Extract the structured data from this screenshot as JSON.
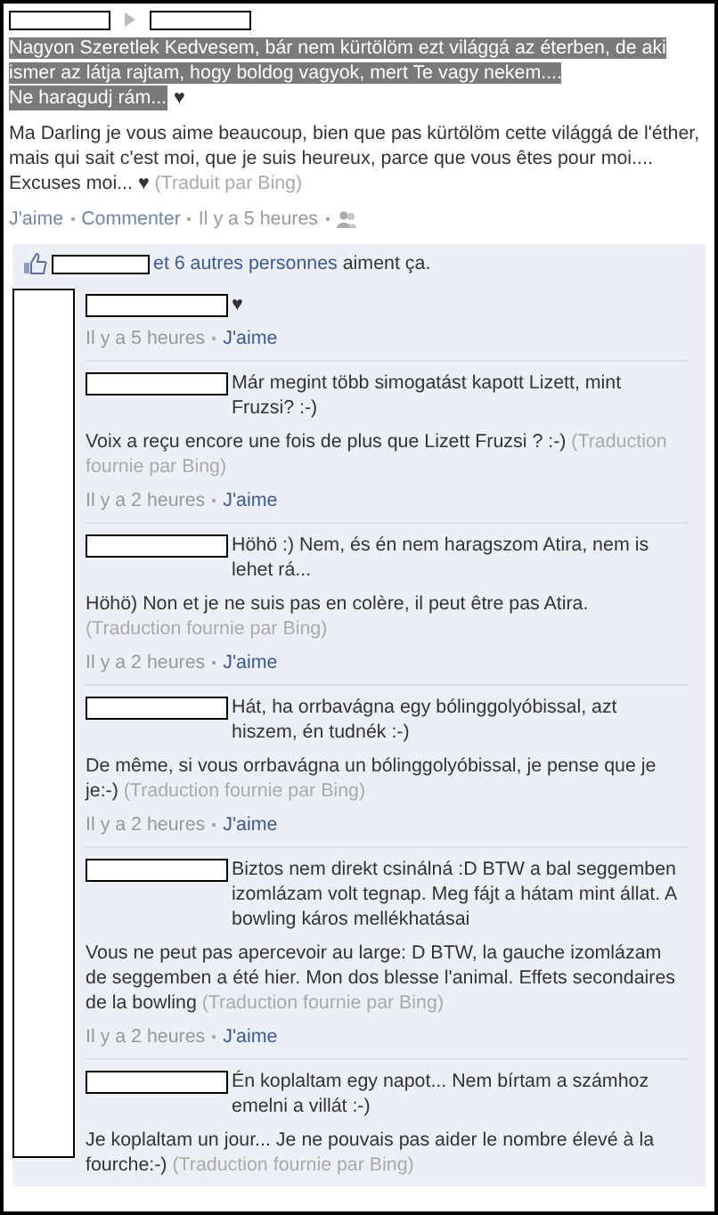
{
  "post": {
    "paragraphs": [
      "Nagyon Szeretlek Kedvesem, bár nem kürtölöm ezt világgá az éterben, de aki ismer az látja rajtam, hogy boldog vagyok, mert Te vagy nekem....",
      "Ne haragudj rám..."
    ],
    "selected": true,
    "heart": "♥",
    "translation": "Ma Darling je vous aime beaucoup, bien que pas kürtölöm cette világgá de l'éther, mais qui sait c'est moi, que je suis heureux, parce que vous êtes pour moi.... Excuses moi... ♥",
    "translation_note": "(Traduit par Bing)",
    "actions": [
      {
        "kind": "link",
        "text": "J'aime"
      },
      {
        "kind": "link",
        "text": "Commenter"
      },
      {
        "kind": "time",
        "text": "Il y a 5 heures"
      },
      {
        "kind": "people"
      }
    ]
  },
  "likes": {
    "link": "et 6 autres personnes",
    "text": "aiment ça."
  },
  "comments": [
    {
      "text": "♥",
      "time": "Il y a 5 heures",
      "like": "J'aime"
    },
    {
      "text": "Már megint több simogatást kapott Lizett, mint Fruzsi? :-)",
      "translation": "Voix a reçu encore une fois de plus que Lizett Fruzsi ? :-)",
      "translation_note": "(Traduction fournie par Bing)",
      "time": "Il y a 2 heures",
      "like": "J'aime"
    },
    {
      "text": "Höhö :) Nem, és én nem haragszom Atira, nem is lehet rá...",
      "translation": "Höhö) Non et je ne suis pas en colère, il peut être pas Atira.",
      "translation_note": "(Traduction fournie par Bing)",
      "time": "Il y a 2 heures",
      "like": "J'aime"
    },
    {
      "text": "Hát, ha orrbavágna egy bólinggolyóbissal, azt hiszem, én tudnék :-)",
      "translation": "De même, si vous orrbavágna un bólinggolyóbissal, je pense que je je:-)",
      "translation_note": "(Traduction fournie par Bing)",
      "time": "Il y a 2 heures",
      "like": "J'aime"
    },
    {
      "text": "Biztos nem direkt csinálná :D BTW a bal seggemben izomlázam volt tegnap. Meg fájt a hátam mint állat. A bowling káros mellékhatásai",
      "translation": "Vous ne peut pas apercevoir au large: D BTW, la gauche izomlázam de seggemben a été hier. Mon dos blesse l'animal. Effets secondaires de la bowling",
      "translation_note": "(Traduction fournie par Bing)",
      "time": "Il y a 2 heures",
      "like": "J'aime"
    },
    {
      "text": "Én koplaltam egy napot... Nem bírtam a számhoz emelni a villát :-)",
      "translation": "Je koplaltam un jour... Je ne pouvais pas aider le nombre élevé à la fourche:-)",
      "translation_note": "(Traduction fournie par Bing)"
    }
  ]
}
